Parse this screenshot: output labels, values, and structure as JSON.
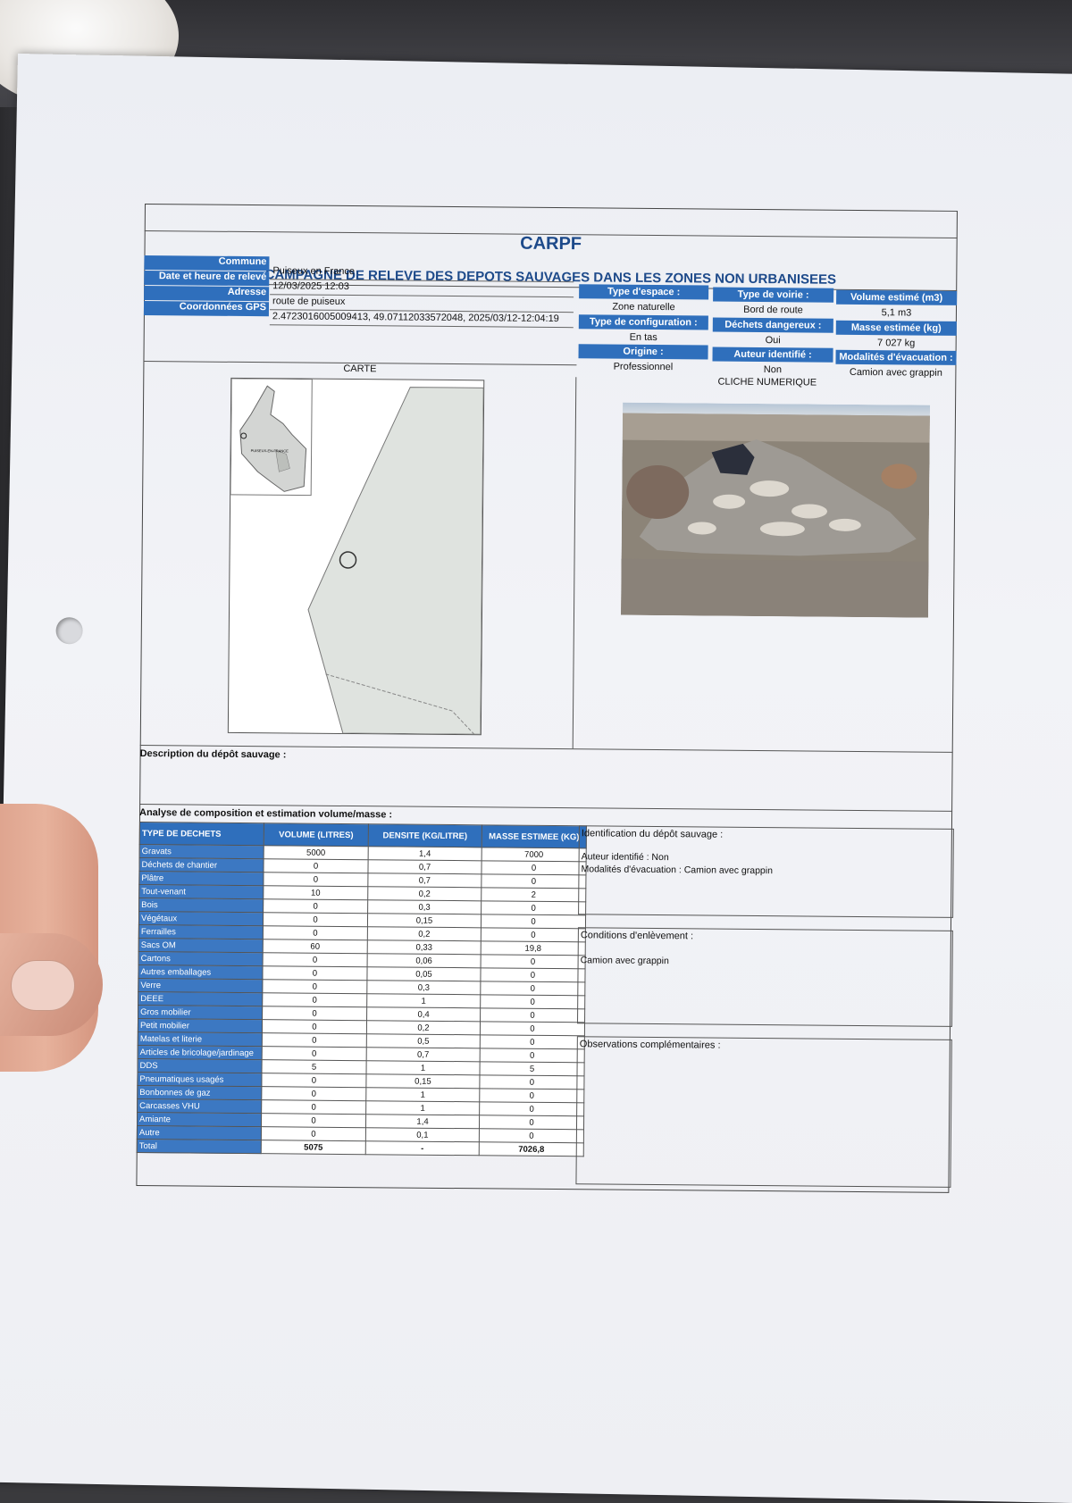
{
  "document": {
    "org": "CARPF",
    "campaign": "CAMPAGNE DE RELEVE DES DEPOTS SAUVAGES DANS LES ZONES NON URBANISEES"
  },
  "info": {
    "commune_label": "Commune",
    "commune": "Puiseux en France",
    "date_label": "Date et heure de relevé",
    "date": "12/03/2025 12:03",
    "adresse_label": "Adresse",
    "adresse": "route de puiseux",
    "gps_label": "Coordonnées GPS",
    "gps": "2.4723016005009413, 49.07112033572048, 2025/03/12-12:04:19"
  },
  "attributes": {
    "type_espace_label": "Type d'espace :",
    "type_espace": "Zone naturelle",
    "type_voirie_label": "Type de voirie :",
    "type_voirie": "Bord de route",
    "volume_label": "Volume estimé (m3)",
    "volume": "5,1 m3",
    "config_label": "Type de configuration :",
    "config": "En tas",
    "dangereux_label": "Déchets dangereux :",
    "dangereux": "Oui",
    "masse_label": "Masse estimée (kg)",
    "masse": "7 027 kg",
    "origine_label": "Origine :",
    "origine": "Professionnel",
    "auteur_label": "Auteur identifié :",
    "auteur": "Non",
    "modalites_label": "Modalités d'évacuation :",
    "modalites": "Camion avec grappin"
  },
  "sections": {
    "carte": "CARTE",
    "cliche": "CLICHE NUMERIQUE",
    "description": "Description du dépôt sauvage :",
    "analyse": "Analyse de composition et estimation volume/masse :",
    "identification": "Identification du dépôt sauvage :",
    "ident_auteur": "Auteur identifié : Non",
    "ident_modalites": "Modalités d'évacuation :  Camion avec grappin",
    "conditions": "Conditions d'enlèvement :",
    "conditions_value": "Camion avec grappin",
    "observations": "Observations complémentaires :"
  },
  "map_inset_label": "PUISEUX-EN-FRANCE",
  "table": {
    "headers": [
      "TYPE DE DECHETS",
      "VOLUME (LITRES)",
      "DENSITE (KG/LITRE)",
      "MASSE ESTIMEE (KG)"
    ],
    "rows": [
      [
        "Gravats",
        "5000",
        "1,4",
        "7000"
      ],
      [
        "Déchets de chantier",
        "0",
        "0,7",
        "0"
      ],
      [
        "Plâtre",
        "0",
        "0,7",
        "0"
      ],
      [
        "Tout-venant",
        "10",
        "0,2",
        "2"
      ],
      [
        "Bois",
        "0",
        "0,3",
        "0"
      ],
      [
        "Végétaux",
        "0",
        "0,15",
        "0"
      ],
      [
        "Ferrailles",
        "0",
        "0,2",
        "0"
      ],
      [
        "Sacs OM",
        "60",
        "0,33",
        "19,8"
      ],
      [
        "Cartons",
        "0",
        "0,06",
        "0"
      ],
      [
        "Autres emballages",
        "0",
        "0,05",
        "0"
      ],
      [
        "Verre",
        "0",
        "0,3",
        "0"
      ],
      [
        "DEEE",
        "0",
        "1",
        "0"
      ],
      [
        "Gros mobilier",
        "0",
        "0,4",
        "0"
      ],
      [
        "Petit mobilier",
        "0",
        "0,2",
        "0"
      ],
      [
        "Matelas et literie",
        "0",
        "0,5",
        "0"
      ],
      [
        "Articles de bricolage/jardinage",
        "0",
        "0,7",
        "0"
      ],
      [
        "DDS",
        "5",
        "1",
        "5"
      ],
      [
        "Pneumatiques usagés",
        "0",
        "0,15",
        "0"
      ],
      [
        "Bonbonnes de gaz",
        "0",
        "1",
        "0"
      ],
      [
        "Carcasses VHU",
        "0",
        "1",
        "0"
      ],
      [
        "Amiante",
        "0",
        "1,4",
        "0"
      ],
      [
        "Autre",
        "0",
        "0,1",
        "0"
      ]
    ],
    "total": [
      "Total",
      "5075",
      "-",
      "7026,8"
    ]
  },
  "colors": {
    "header_blue": "#2f6fbc",
    "title_blue": "#1d4a8a",
    "map_fill": "#dfe3df"
  }
}
